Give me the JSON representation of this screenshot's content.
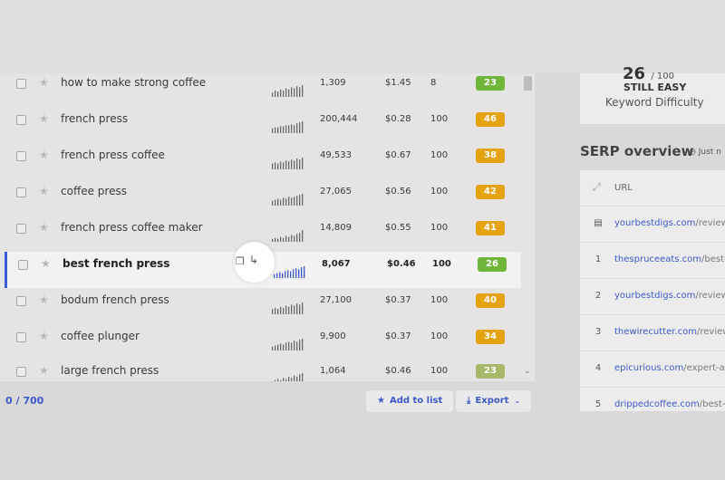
{
  "keywords": {
    "rows": [
      {
        "keyword": "how to make strong coffee",
        "volume": "1,309",
        "cpc": "$1.45",
        "comp": "8",
        "kd": "23",
        "kd_color": "#6fb63a",
        "bars": [
          4,
          6,
          5,
          7,
          6,
          8,
          7,
          9,
          8,
          10,
          9,
          11
        ]
      },
      {
        "keyword": "french press",
        "volume": "200,444",
        "cpc": "$0.28",
        "comp": "100",
        "kd": "46",
        "kd_color": "#e5a312",
        "bars": [
          5,
          6,
          6,
          7,
          7,
          8,
          8,
          9,
          8,
          10,
          11,
          12
        ]
      },
      {
        "keyword": "french press coffee",
        "volume": "49,533",
        "cpc": "$0.67",
        "comp": "100",
        "kd": "38",
        "kd_color": "#e5a312",
        "bars": [
          6,
          7,
          6,
          8,
          7,
          9,
          8,
          10,
          9,
          11,
          10,
          12
        ]
      },
      {
        "keyword": "coffee press",
        "volume": "27,065",
        "cpc": "$0.56",
        "comp": "100",
        "kd": "42",
        "kd_color": "#e5a312",
        "bars": [
          5,
          6,
          7,
          6,
          8,
          7,
          9,
          8,
          9,
          10,
          11,
          12
        ]
      },
      {
        "keyword": "french press coffee maker",
        "volume": "14,809",
        "cpc": "$0.55",
        "comp": "100",
        "kd": "41",
        "kd_color": "#e5a312",
        "bars": [
          3,
          4,
          3,
          5,
          4,
          6,
          5,
          7,
          6,
          8,
          9,
          12
        ]
      },
      {
        "keyword": "best french press",
        "volume": "8,067",
        "cpc": "$0.46",
        "comp": "100",
        "kd": "26",
        "kd_color": "#6fb63a",
        "bars": [
          4,
          5,
          6,
          5,
          7,
          8,
          7,
          9,
          10,
          9,
          11,
          12
        ]
      },
      {
        "keyword": "bodum french press",
        "volume": "27,100",
        "cpc": "$0.37",
        "comp": "100",
        "kd": "40",
        "kd_color": "#e5a312",
        "bars": [
          5,
          6,
          5,
          7,
          6,
          8,
          7,
          9,
          8,
          10,
          9,
          11
        ]
      },
      {
        "keyword": "coffee plunger",
        "volume": "9,900",
        "cpc": "$0.37",
        "comp": "100",
        "kd": "34",
        "kd_color": "#e5a312",
        "bars": [
          4,
          5,
          6,
          7,
          6,
          8,
          9,
          8,
          10,
          9,
          11,
          12
        ]
      },
      {
        "keyword": "large french press",
        "volume": "1,064",
        "cpc": "$0.46",
        "comp": "100",
        "kd": "23",
        "kd_color": "#a8b86a",
        "bars": [
          3,
          4,
          5,
          4,
          6,
          5,
          7,
          6,
          8,
          7,
          9,
          10
        ]
      }
    ]
  },
  "footer": {
    "count": "0 / 700",
    "add_to_list": "Add to list",
    "export": "Export"
  },
  "kd_card": {
    "value": "26",
    "max": "/ 100",
    "label": "STILL EASY",
    "sub": "Keyword Difficulty"
  },
  "serp": {
    "title": "SERP overview",
    "time": "Just n",
    "url_header": "URL",
    "rows": [
      {
        "rank": "",
        "domain": "yourbestdigs.com",
        "path": "/review"
      },
      {
        "rank": "1",
        "domain": "thespruceeats.com",
        "path": "/best-"
      },
      {
        "rank": "2",
        "domain": "yourbestdigs.com",
        "path": "/review"
      },
      {
        "rank": "3",
        "domain": "thewirecutter.com",
        "path": "/review"
      },
      {
        "rank": "4",
        "domain": "epicurious.com",
        "path": "/expert-ad"
      },
      {
        "rank": "5",
        "domain": "drippedcoffee.com",
        "path": "/best-"
      }
    ]
  }
}
